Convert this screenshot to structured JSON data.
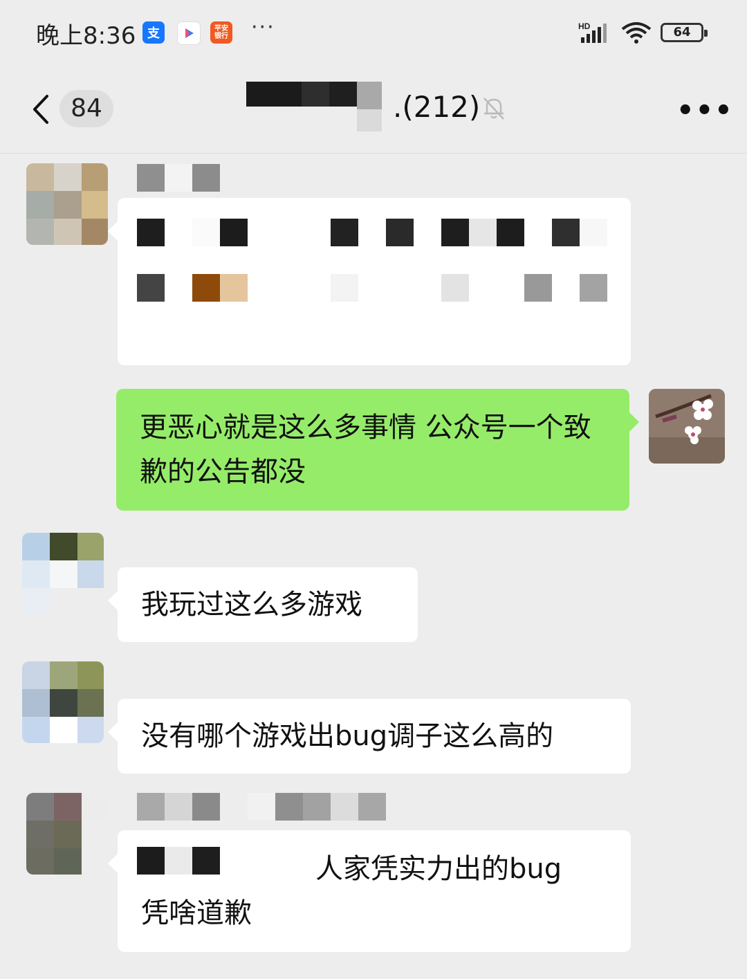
{
  "status_bar": {
    "time": "晚上8:36",
    "alipay_icon": "支",
    "pingan_icon": "平安\n银行",
    "overflow_dots": "···",
    "network": "HD",
    "battery": "64"
  },
  "header": {
    "unread_count": "84",
    "title_suffix": ".(212)",
    "menu_dots": "•••"
  },
  "messages": [
    {
      "side": "left",
      "text": ""
    },
    {
      "side": "right",
      "text": "更恶心就是这么多事情 公众号一个致歉的公告都没"
    },
    {
      "side": "left",
      "text": "我玩过这么多游戏"
    },
    {
      "side": "left",
      "text": "没有哪个游戏出bug调子这么高的"
    },
    {
      "side": "left",
      "text_line1": "人家凭实力出的bug",
      "text_line2": "凭啥道歉"
    }
  ],
  "colors": {
    "background": "#ededed",
    "bubble_self": "#95ec69",
    "bubble_other": "#ffffff"
  }
}
